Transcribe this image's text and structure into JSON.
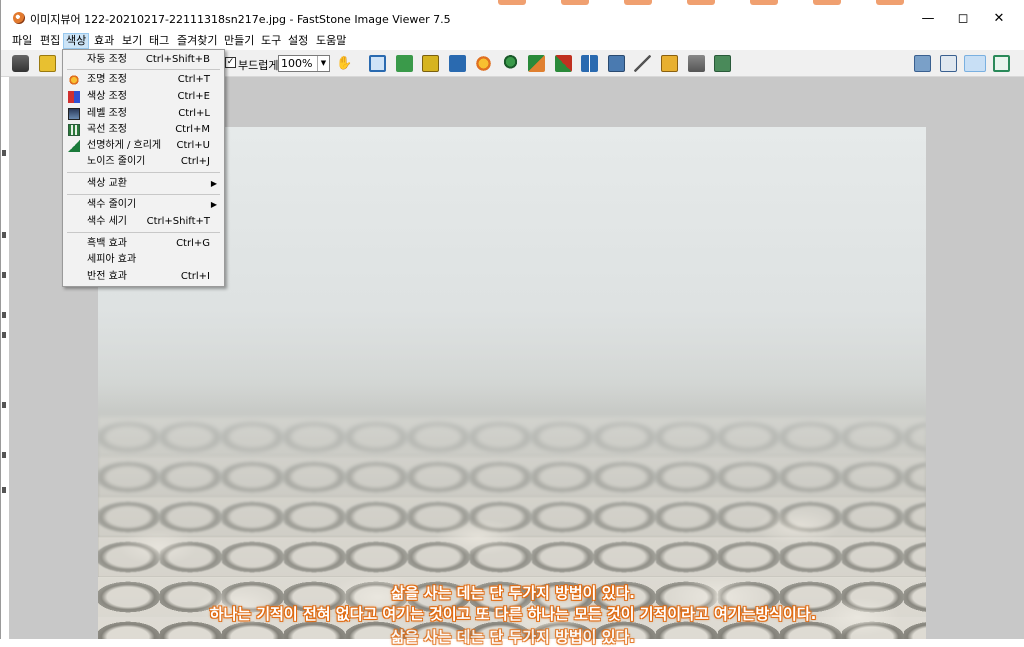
{
  "window": {
    "title": "이미지뷰어 122-20210217-22111318sn217e.jpg  -  FastStone Image Viewer 7.5",
    "minimize_icon": "minimize-icon",
    "maximize_icon": "maximize-icon",
    "close_icon": "close-icon"
  },
  "menubar": {
    "items": [
      "파일",
      "편집",
      "색상",
      "효과",
      "보기",
      "태그",
      "즐겨찾기",
      "만들기",
      "도구",
      "설정",
      "도움말"
    ],
    "active_index": 2
  },
  "toolbar": {
    "smooth_label": "부드럽게",
    "smooth_checked": true,
    "zoom_value": "100%"
  },
  "color_menu": {
    "items": [
      {
        "label": "자동 조정",
        "shortcut": "Ctrl+Shift+B",
        "icon": ""
      },
      {
        "label": "조명 조정",
        "shortcut": "Ctrl+T",
        "icon": "sun-icon"
      },
      {
        "label": "색상 조정",
        "shortcut": "Ctrl+E",
        "icon": "rgb-blocks-icon"
      },
      {
        "label": "레벨 조정",
        "shortcut": "Ctrl+L",
        "icon": "levels-icon"
      },
      {
        "label": "곡선 조정",
        "shortcut": "Ctrl+M",
        "icon": "curves-icon"
      },
      {
        "label": "선명하게 / 흐리게",
        "shortcut": "Ctrl+U",
        "icon": "sharpen-icon"
      },
      {
        "label": "노이즈 줄이기",
        "shortcut": "Ctrl+J",
        "icon": ""
      },
      {
        "label": "색상 교환",
        "shortcut": "",
        "submenu": true
      },
      {
        "label": "색수 줄이기",
        "shortcut": "",
        "submenu": true
      },
      {
        "label": "색수 세기",
        "shortcut": "Ctrl+Shift+T"
      },
      {
        "label": "흑백 효과",
        "shortcut": "Ctrl+G"
      },
      {
        "label": "세피아 효과",
        "shortcut": ""
      },
      {
        "label": "반전 효과",
        "shortcut": "Ctrl+I"
      }
    ]
  },
  "image_caption": {
    "line1": "삶을 사는 데는 단 두가지 방법이 있다.",
    "line2": "하나는 기적이 전혀 없다고 여기는 것이고 또 다른 하나는 모든 것이 기적이라고 여기는방식이다.",
    "line3": "삶을 사는 데는 단 두가지 방법이 있다."
  },
  "colors": {
    "menu_highlight": "#cce4f7",
    "caption_outline": "#e06a10",
    "viewer_bg": "#c8c8c8"
  }
}
